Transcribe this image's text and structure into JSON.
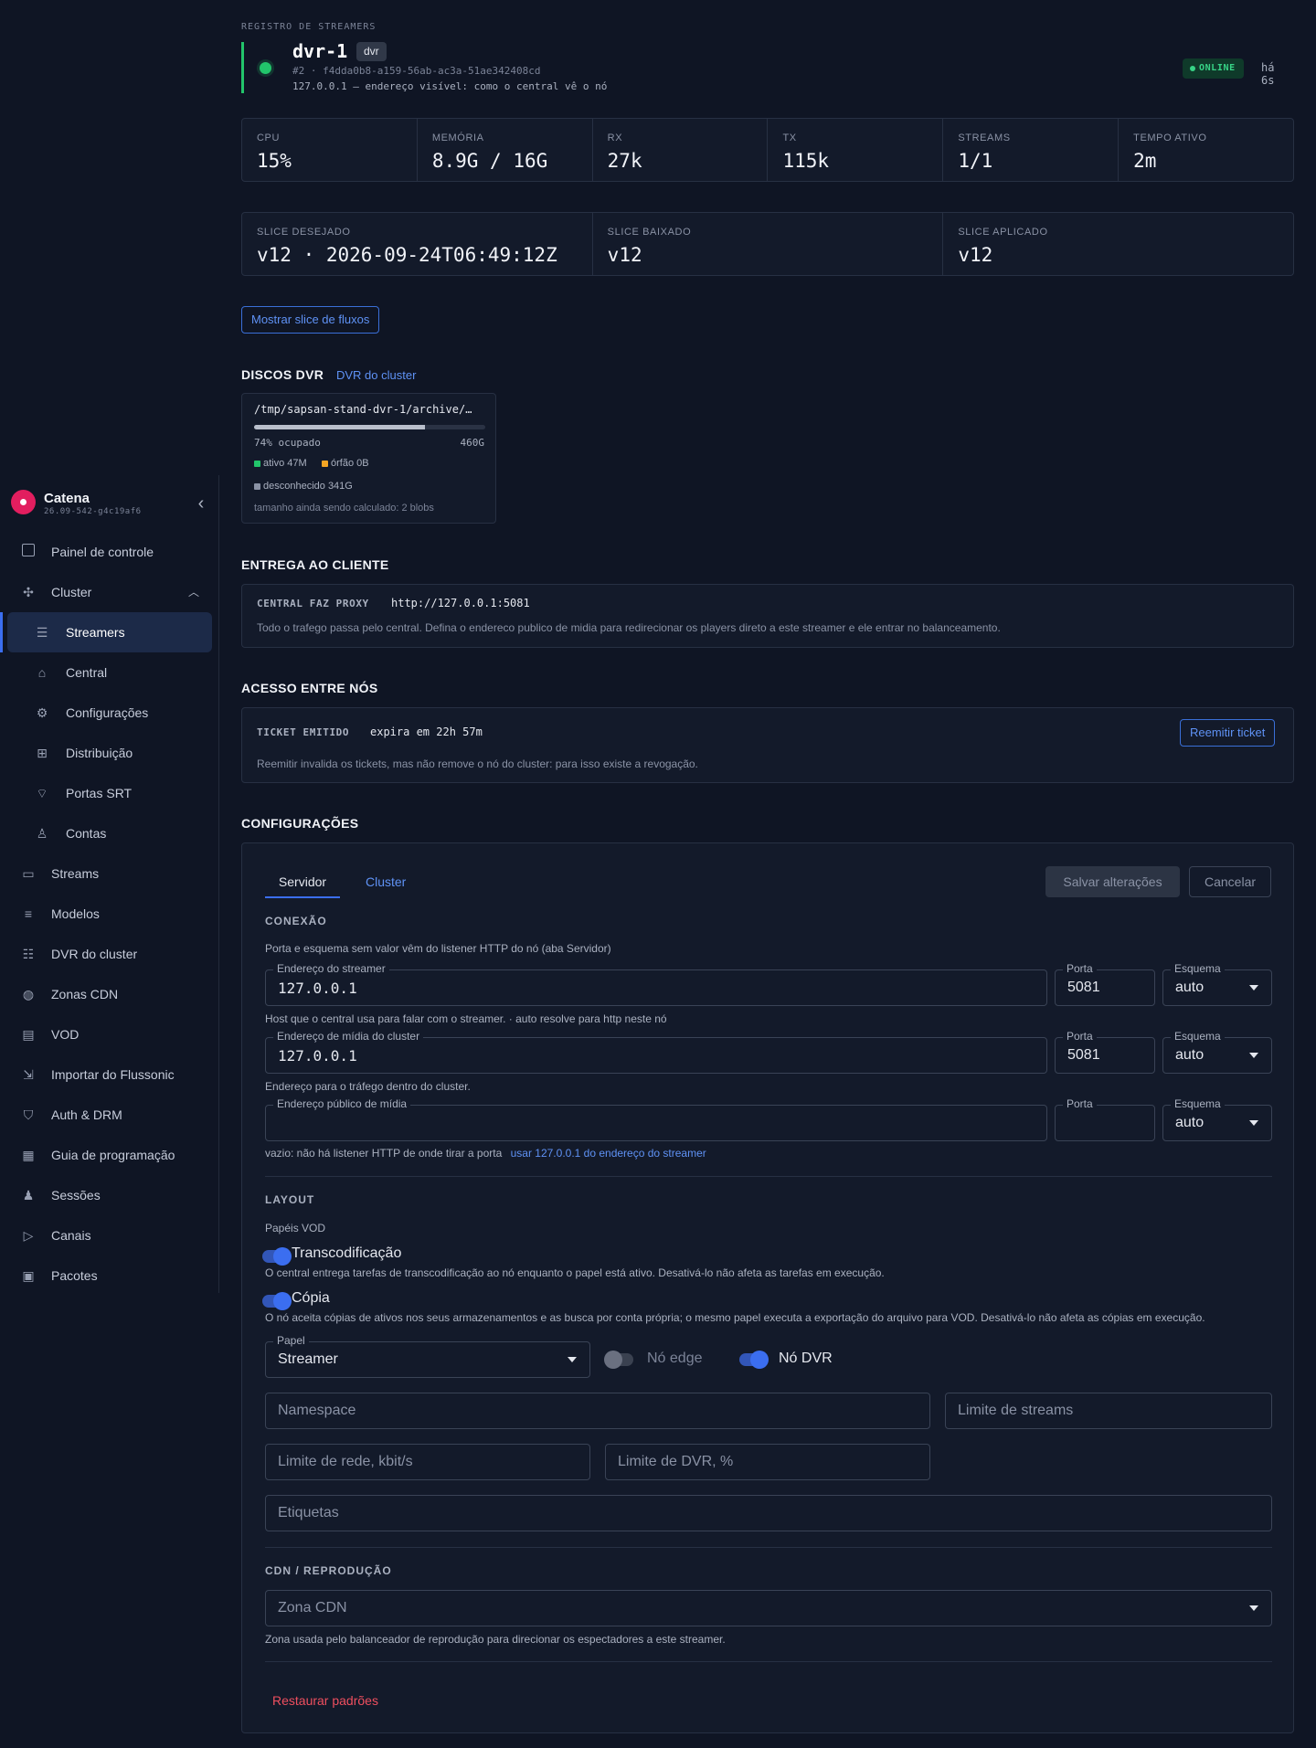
{
  "app": {
    "name": "Catena",
    "version": "26.09-542-g4c19af6"
  },
  "nav": {
    "items": [
      {
        "key": "dashboard",
        "label": "Painel de controle",
        "icon": "layout-icon"
      },
      {
        "key": "cluster",
        "label": "Cluster",
        "icon": "cluster-icon"
      },
      {
        "key": "streamers",
        "label": "Streamers",
        "icon": "server-icon"
      },
      {
        "key": "central",
        "label": "Central",
        "icon": "bank-icon"
      },
      {
        "key": "settings",
        "label": "Configurações",
        "icon": "gear-icon"
      },
      {
        "key": "distribution",
        "label": "Distribuição",
        "icon": "hierarchy-icon"
      },
      {
        "key": "srt",
        "label": "Portas SRT",
        "icon": "antenna-icon"
      },
      {
        "key": "accounts",
        "label": "Contas",
        "icon": "users-icon"
      },
      {
        "key": "streams",
        "label": "Streams",
        "icon": "monitor-icon"
      },
      {
        "key": "templates",
        "label": "Modelos",
        "icon": "sliders-icon"
      },
      {
        "key": "cluster-dvr",
        "label": "DVR do cluster",
        "icon": "list-icon"
      },
      {
        "key": "cdn",
        "label": "Zonas CDN",
        "icon": "globe-icon"
      },
      {
        "key": "vod",
        "label": "VOD",
        "icon": "film-icon"
      },
      {
        "key": "flussonic",
        "label": "Importar do Flussonic",
        "icon": "import-icon"
      },
      {
        "key": "auth",
        "label": "Auth & DRM",
        "icon": "shield-icon"
      },
      {
        "key": "epg",
        "label": "Guia de programação",
        "icon": "calendar-icon"
      },
      {
        "key": "sessions",
        "label": "Sessões",
        "icon": "group-icon"
      },
      {
        "key": "channels",
        "label": "Canais",
        "icon": "play-icon"
      },
      {
        "key": "packages",
        "label": "Pacotes",
        "icon": "archive-icon"
      }
    ]
  },
  "header": {
    "breadcrumb": "REGISTRO DE STREAMERS",
    "name": "dvr-1",
    "role": "dvr",
    "id": "#2 · f4dda0b8-a159-56ab-ac3a-51ae342408cd",
    "address": "127.0.0.1 — endereço visível: como o central vê o nó",
    "status": "ONLINE",
    "last_seen": "há 6s",
    "status_color": "#22c56b"
  },
  "stats": [
    {
      "label": "CPU",
      "value": "15%"
    },
    {
      "label": "MEMÓRIA",
      "value": "8.9G / 16G"
    },
    {
      "label": "RX",
      "value": "27k"
    },
    {
      "label": "TX",
      "value": "115k"
    },
    {
      "label": "STREAMS",
      "value": "1/1"
    },
    {
      "label": "TEMPO ATIVO",
      "value": "2m"
    }
  ],
  "slices": [
    {
      "label": "SLICE DESEJADO",
      "value": "v12 · 2026-09-24T06:49:12Z"
    },
    {
      "label": "SLICE BAIXADO",
      "value": "v12"
    },
    {
      "label": "SLICE APLICADO",
      "value": "v12"
    }
  ],
  "show_slice_button": "Mostrar slice de fluxos",
  "disks": {
    "title": "DISCOS DVR",
    "link": "DVR do cluster",
    "path": "/tmp/sapsan-stand-dvr-1/archive/…",
    "used_fraction": 0.74,
    "usage": "74% ocupado",
    "size": "460G",
    "active": "ativo 47M",
    "orphan": "órfão 0B",
    "unknown": "desconhecido 341G",
    "note": "tamanho ainda sendo calculado: 2 blobs",
    "colors": {
      "active": "#22c56b",
      "orphan": "#f5a524",
      "unknown": "#8a92a5"
    }
  },
  "delivery": {
    "title": "ENTREGA AO CLIENTE",
    "key": "CENTRAL FAZ PROXY",
    "value": "http://127.0.0.1:5081",
    "note": "Todo o trafego passa pelo central. Defina o endereco publico de midia para redirecionar os players direto a este streamer e ele entrar no balanceamento."
  },
  "access": {
    "title": "ACESSO ENTRE NÓS",
    "key": "TICKET EMITIDO",
    "value": "expira em 22h 57m",
    "button": "Reemitir ticket",
    "note": "Reemitir invalida os tickets, mas não remove o nó do cluster: para isso existe a revogação."
  },
  "config": {
    "title": "CONFIGURAÇÕES",
    "tabs": [
      "Servidor",
      "Cluster"
    ],
    "save": "Salvar alterações",
    "cancel": "Cancelar",
    "connection": {
      "title": "CONEXÃO",
      "hint": "Porta e esquema sem valor vêm do listener HTTP do nó (aba Servidor)",
      "streamer": {
        "label": "Endereço do streamer",
        "value": "127.0.0.1",
        "port_label": "Porta",
        "port": "5081",
        "scheme_label": "Esquema",
        "scheme": "auto",
        "help": "Host que o central usa para falar com o streamer. · auto resolve para http neste nó"
      },
      "cluster_media": {
        "label": "Endereço de mídia do cluster",
        "value": "127.0.0.1",
        "port_label": "Porta",
        "port": "5081",
        "scheme_label": "Esquema",
        "scheme": "auto",
        "help": "Endereço para o tráfego dentro do cluster."
      },
      "public_media": {
        "label": "Endereço público de mídia",
        "value": "",
        "port_label": "Porta",
        "port": "",
        "scheme_label": "Esquema",
        "scheme": "auto",
        "help": "vazio: não há listener HTTP de onde tirar a porta",
        "help_link": "usar 127.0.0.1 do endereço do streamer"
      }
    },
    "layout": {
      "title": "LAYOUT",
      "vod_roles": "Papéis VOD",
      "transcode": {
        "label": "Transcodificação",
        "on": true,
        "desc": "O central entrega tarefas de transcodificação ao nó enquanto o papel está ativo. Desativá-lo não afeta as tarefas em execução."
      },
      "copy": {
        "label": "Cópia",
        "on": true,
        "desc": "O nó aceita cópias de ativos nos seus armazenamentos e as busca por conta própria; o mesmo papel executa a exportação do arquivo para VOD. Desativá-lo não afeta as cópias em execução."
      },
      "role_label": "Papel",
      "role": "Streamer",
      "edge": {
        "label": "Nó edge",
        "on": false
      },
      "dvr": {
        "label": "Nó DVR",
        "on": true
      },
      "namespace_ph": "Namespace",
      "stream_limit_ph": "Limite de streams",
      "net_limit_ph": "Limite de rede, kbit/s",
      "dvr_limit_ph": "Limite de DVR, %",
      "tags_ph": "Etiquetas"
    },
    "cdn": {
      "title": "CDN / REPRODUÇÃO",
      "zone_ph": "Zona CDN",
      "help": "Zona usada pelo balanceador de reprodução para direcionar os espectadores a este streamer."
    },
    "restore": "Restaurar padrões"
  }
}
